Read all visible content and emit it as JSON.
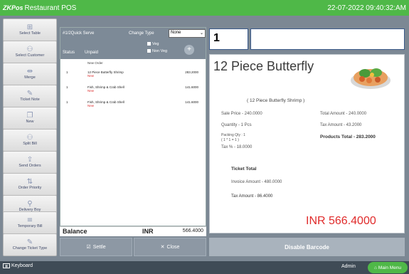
{
  "app": {
    "logo": "ZKPos",
    "title": "Restaurant POS",
    "datetime": "22-07-2022 09:40:32:AM"
  },
  "sidebar": {
    "items": [
      {
        "label": "Select Table",
        "icon": "table-icon",
        "glyph": "⊞"
      },
      {
        "label": "Select Customer",
        "icon": "customer-icon",
        "glyph": "⚇"
      },
      {
        "label": "Merge",
        "icon": "merge-icon",
        "glyph": "⇹"
      },
      {
        "label": "Ticket Note",
        "icon": "note-icon",
        "glyph": "✎"
      },
      {
        "label": "New",
        "icon": "new-icon",
        "glyph": "❐"
      },
      {
        "label": "Split Bill",
        "icon": "split-icon",
        "glyph": "⚇"
      },
      {
        "label": "Send Orders",
        "icon": "send-icon",
        "glyph": "⇪"
      },
      {
        "label": "Order Priority",
        "icon": "priority-icon",
        "glyph": "⇅"
      },
      {
        "label": "Delivery Boy",
        "icon": "delivery-icon",
        "glyph": "⚲"
      },
      {
        "label": "Temporary Bill",
        "icon": "temp-bill-icon",
        "glyph": "≡"
      },
      {
        "label": "Change Ticket Type",
        "icon": "ticket-type-icon",
        "glyph": "✎"
      }
    ]
  },
  "order": {
    "order_no": "#1/2Quick Serve",
    "change_type_label": "Change Type",
    "change_type_value": "None",
    "veg_label": "Veg",
    "nonveg_label": "Non Veg",
    "status_label": "Status",
    "status_value": "Unpaid",
    "add_symbol": "+",
    "new_order_label": "New Order",
    "items": [
      {
        "qty": "1",
        "name": "12 Piece Butterfly Shrimp",
        "tag": "New",
        "amount": "283.2000"
      },
      {
        "qty": "1",
        "name": "Fish, Shrimp & Crab Shell",
        "tag": "New",
        "amount": "141.6000"
      },
      {
        "qty": "1",
        "name": "Fish, Shrimp & Crab Shell",
        "tag": "New",
        "amount": "141.6000"
      }
    ],
    "balance_label": "Balance",
    "currency": "INR",
    "balance_value": "566.4000",
    "settle_label": "Settle",
    "close_label": "Close"
  },
  "entry": {
    "qty_value": "1",
    "code_value": ""
  },
  "product": {
    "name": "12 Piece Butterfly",
    "full_name": "( 12 Piece Butterfly Shrimp )",
    "sale_price": "Sale Price - 240.0000",
    "quantity": "Quantity - 1 Pcs",
    "packing_qty": "Packing Qty : 1",
    "packing_formula": "( 1 * 1 = 1 )",
    "tax_percent": "Tax % - 18.0000",
    "total_amount": "Total Amount - 240.0000",
    "tax_amount": "Tax Amount - 43.2000",
    "products_total": "Products Total - 283.2000"
  },
  "ticket": {
    "title": "Ticket Total",
    "invoice_amount": "Invoice Amount - 480.0000",
    "tax_amount": "Tax Amount - 86.4000",
    "grand_total": "INR 566.4000"
  },
  "disable_barcode_label": "Disable Barcode",
  "bottom": {
    "keyboard_label": "Keyboard",
    "user": "Admin",
    "main_menu_label": "Main Menu"
  },
  "colors": {
    "accent": "#4fb848",
    "header_bg": "#7d8a97",
    "total_red": "#e02b2b"
  }
}
